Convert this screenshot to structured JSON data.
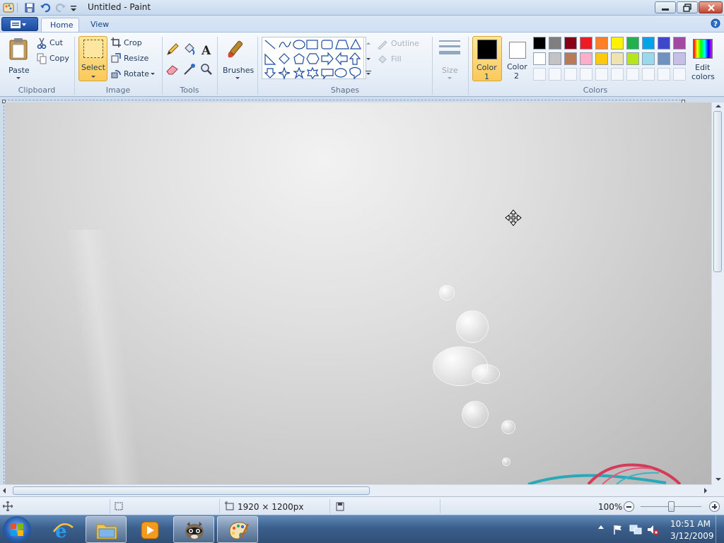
{
  "window": {
    "title": "Untitled - Paint"
  },
  "tabs": [
    {
      "label": "Home"
    },
    {
      "label": "View"
    }
  ],
  "ribbon": {
    "clipboard": {
      "paste": "Paste",
      "cut": "Cut",
      "copy": "Copy",
      "group": "Clipboard"
    },
    "image": {
      "select": "Select",
      "crop": "Crop",
      "resize": "Resize",
      "rotate": "Rotate",
      "group": "Image"
    },
    "tools": {
      "group": "Tools"
    },
    "brushes": {
      "label": "Brushes"
    },
    "shapes": {
      "outline": "Outline",
      "fill": "Fill",
      "group": "Shapes"
    },
    "size": {
      "label": "Size"
    },
    "colors": {
      "color1_line1": "Color",
      "color1_line2": "1",
      "color2_line1": "Color",
      "color2_line2": "2",
      "edit_line1": "Edit",
      "edit_line2": "colors",
      "group": "Colors",
      "color1": "#000000",
      "color2": "#ffffff",
      "palette_row1": [
        "#000000",
        "#7f7f7f",
        "#880015",
        "#ed1c24",
        "#ff7f27",
        "#fff200",
        "#22b14c",
        "#00a2e8",
        "#3f48cc",
        "#a349a4"
      ],
      "palette_row2": [
        "#ffffff",
        "#c3c3c3",
        "#b97a57",
        "#ffaec9",
        "#ffc90e",
        "#efe4b0",
        "#b5e61d",
        "#99d9ea",
        "#7092be",
        "#c8bfe7"
      ]
    }
  },
  "status": {
    "image_size": "1920 × 1200px",
    "zoom": "100%"
  },
  "taskbar": {
    "time": "10:51 AM",
    "date": "3/12/2009"
  }
}
